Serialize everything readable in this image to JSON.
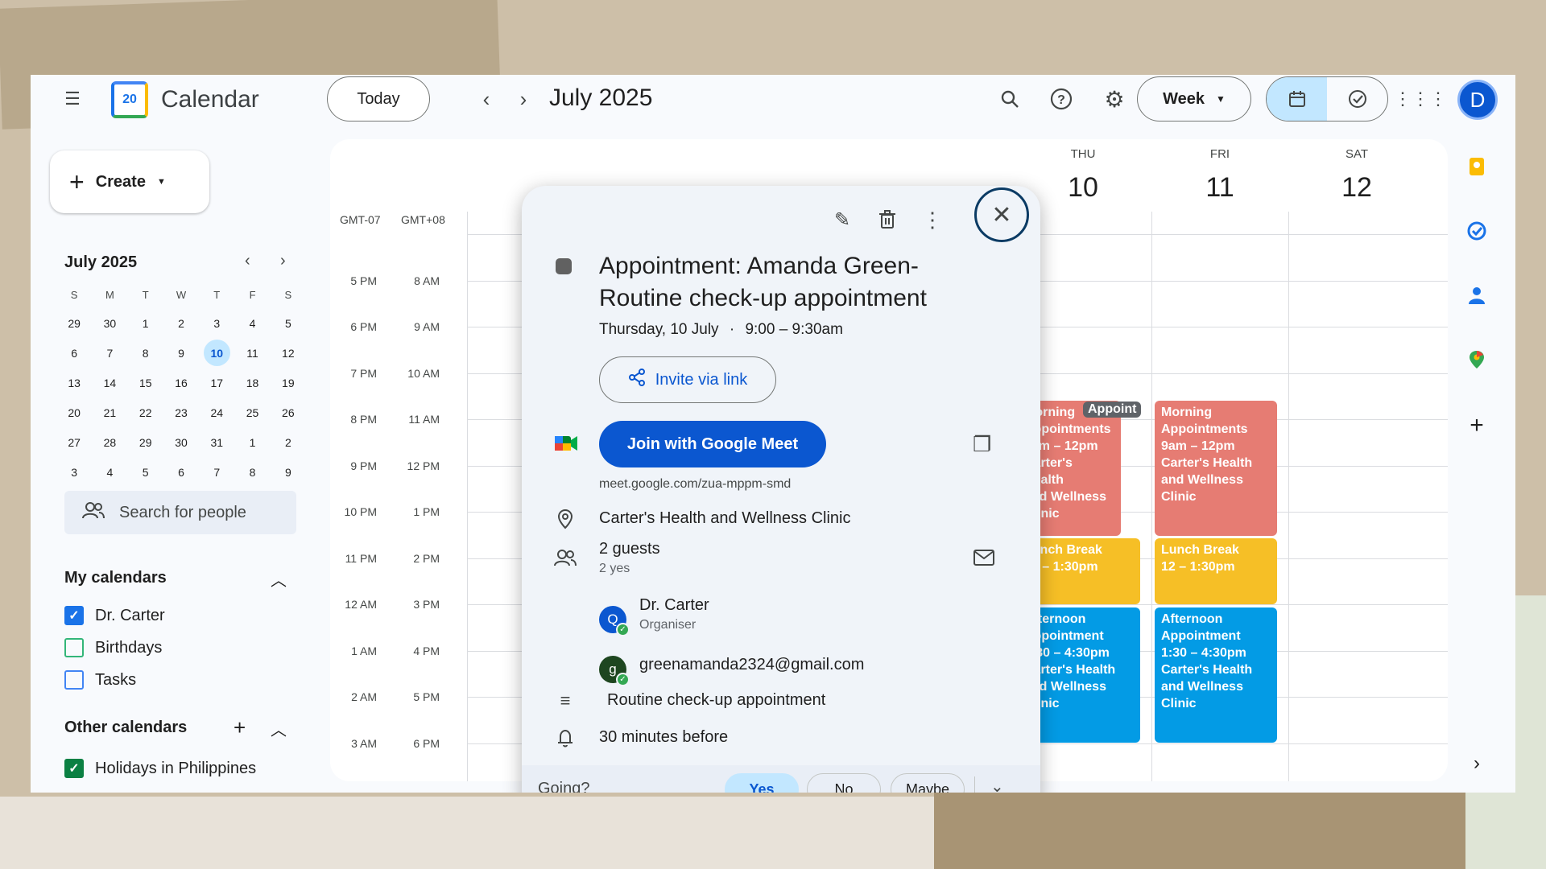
{
  "topbar": {
    "app_name": "Calendar",
    "logo_day": "20",
    "today_label": "Today",
    "month_title": "July 2025",
    "view_label": "Week",
    "avatar_initial": "D"
  },
  "sidebar": {
    "create_label": "Create",
    "mini_month": "July 2025",
    "dow": [
      "S",
      "M",
      "T",
      "W",
      "T",
      "F",
      "S"
    ],
    "days": [
      "29",
      "30",
      "1",
      "2",
      "3",
      "4",
      "5",
      "6",
      "7",
      "8",
      "9",
      "10",
      "11",
      "12",
      "13",
      "14",
      "15",
      "16",
      "17",
      "18",
      "19",
      "20",
      "21",
      "22",
      "23",
      "24",
      "25",
      "26",
      "27",
      "28",
      "29",
      "30",
      "31",
      "1",
      "2",
      "3",
      "4",
      "5",
      "6",
      "7",
      "8",
      "9"
    ],
    "selected_day": "10",
    "search_people_placeholder": "Search for people",
    "my_calendars_title": "My calendars",
    "my_calendars": [
      {
        "label": "Dr. Carter",
        "checked": true,
        "color": "#1a73e8"
      },
      {
        "label": "Birthdays",
        "checked": false,
        "color": "#33b679"
      },
      {
        "label": "Tasks",
        "checked": false,
        "color": "#4285f4"
      }
    ],
    "other_calendars_title": "Other calendars",
    "other_calendars": [
      {
        "label": "Holidays in Philippines",
        "checked": true,
        "color": "#0b8043"
      }
    ]
  },
  "grid": {
    "tz_primary": "GMT-07",
    "tz_secondary": "GMT+08",
    "times_primary": [
      "5 PM",
      "6 PM",
      "7 PM",
      "8 PM",
      "9 PM",
      "10 PM",
      "11 PM",
      "12 AM",
      "1 AM",
      "2 AM",
      "3 AM"
    ],
    "times_secondary": [
      "8 AM",
      "9 AM",
      "10 AM",
      "11 AM",
      "12 PM",
      "1 PM",
      "2 PM",
      "3 PM",
      "4 PM",
      "5 PM",
      "6 PM"
    ],
    "days": [
      {
        "dow": "THU",
        "date": "10"
      },
      {
        "dow": "FRI",
        "date": "11"
      },
      {
        "dow": "SAT",
        "date": "12"
      }
    ],
    "events": {
      "thu_morning": [
        "Morning",
        "Appointments",
        "9am – 12pm",
        "Carter's Health",
        "and Wellness",
        "Clinic"
      ],
      "thu_chip": "Appoint",
      "fri_morning": [
        "Morning",
        "Appointments",
        "9am – 12pm",
        "Carter's Health",
        "and Wellness",
        "Clinic"
      ],
      "lunch": [
        "Lunch Break",
        "12 – 1:30pm"
      ],
      "afternoon": [
        "Afternoon",
        "Appointment",
        "1:30 – 4:30pm",
        "Carter's Health",
        "and Wellness",
        "Clinic"
      ]
    },
    "colors": {
      "morning": "#e67c73",
      "lunch": "#f6bf26",
      "afternoon": "#039be5"
    }
  },
  "popup": {
    "title": "Appointment: Amanda Green- Routine check-up appointment",
    "date": "Thursday, 10 July",
    "separator": "·",
    "time": "9:00 – 9:30am",
    "invite_label": "Invite via link",
    "meet_label": "Join with Google Meet",
    "meet_url": "meet.google.com/zua-mppm-smd",
    "location": "Carter's Health and Wellness Clinic",
    "guests_count": "2 guests",
    "guests_yes": "2 yes",
    "guests": [
      {
        "initial": "Q",
        "name": "Dr. Carter",
        "role": "Organiser",
        "color": "#0b57d0"
      },
      {
        "initial": "g",
        "name": "greenamanda2324@gmail.com",
        "role": "",
        "color": "#1e4620"
      }
    ],
    "description": "Routine check-up appointment",
    "reminder": "30 minutes before",
    "going_label": "Going?",
    "rsvp": {
      "yes": "Yes",
      "no": "No",
      "maybe": "Maybe"
    }
  }
}
